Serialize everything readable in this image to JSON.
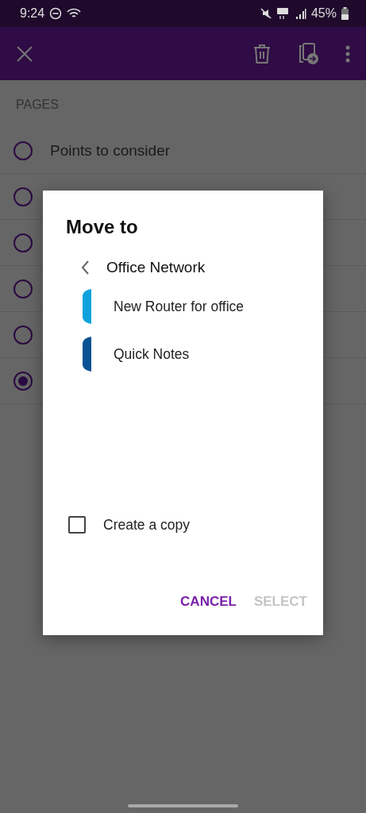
{
  "status_bar": {
    "time": "9:24",
    "battery": "45%"
  },
  "pages": {
    "header": "PAGES",
    "items": [
      {
        "title": "Points to consider",
        "selected": false
      },
      {
        "selected": false
      },
      {
        "selected": false
      },
      {
        "selected": false
      },
      {
        "selected": false
      },
      {
        "selected": true
      }
    ]
  },
  "dialog": {
    "title": "Move to",
    "path": "Office Network",
    "sections": [
      {
        "name": "New Router for office",
        "color": "#0ea2dc"
      },
      {
        "name": "Quick Notes",
        "color": "#0a5294"
      }
    ],
    "copy_option": {
      "label": "Create a copy",
      "checked": false
    },
    "buttons": [
      {
        "label": "CANCEL",
        "disabled": false
      },
      {
        "label": "SELECT",
        "disabled": true
      }
    ]
  }
}
